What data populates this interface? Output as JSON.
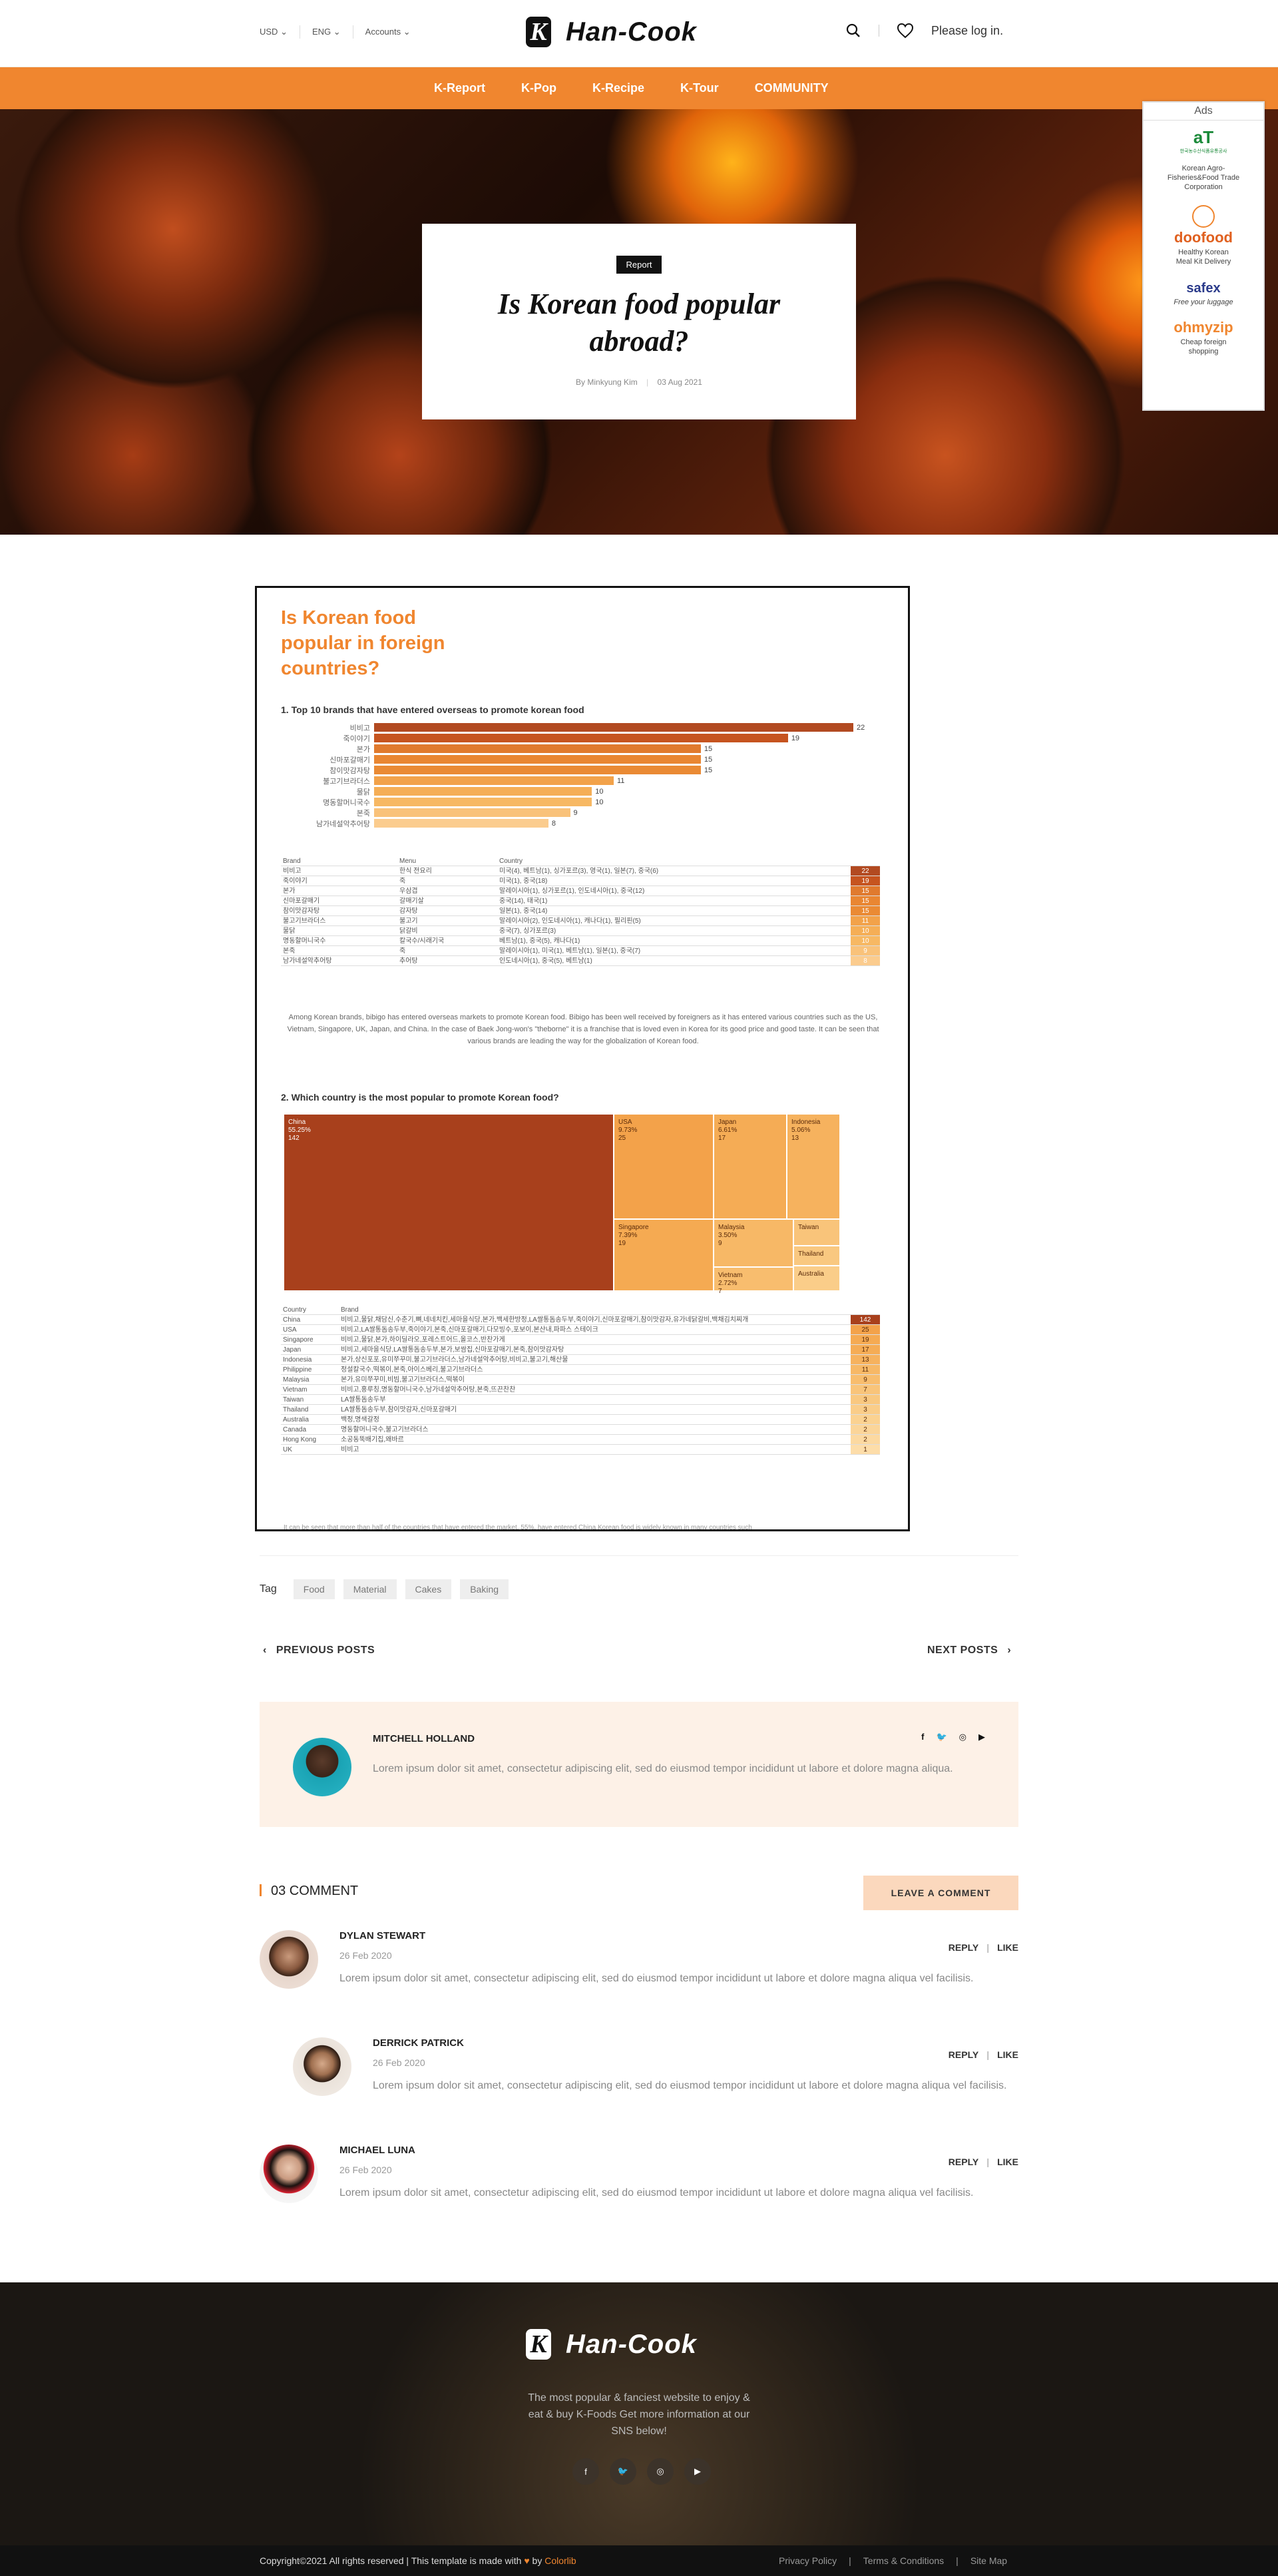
{
  "header": {
    "currency": "USD",
    "language": "ENG",
    "accounts": "Accounts",
    "brand": "Han-Cook",
    "brand_mark": "K",
    "login": "Please log in."
  },
  "nav": [
    "K-Report",
    "K-Pop",
    "K-Recipe",
    "K-Tour",
    "COMMUNITY"
  ],
  "hero": {
    "badge": "Report",
    "title": "Is Korean food popular abroad?",
    "author": "By Minkyung Kim",
    "date": "03 Aug 2021"
  },
  "ads": {
    "title": "Ads",
    "items": [
      {
        "logo": "aT",
        "sub": "한국농수산식품유통공사",
        "desc": "Korean Agro-Fisheries&Food Trade Corporation"
      },
      {
        "logo": "doofood",
        "desc": "Healthy Korean Meal Kit Delivery"
      },
      {
        "logo": "safex",
        "desc": "Free your luggage"
      },
      {
        "logo": "ohmyzip",
        "desc": "Cheap foreign shopping"
      }
    ]
  },
  "article": {
    "heading": "Is Korean food popular in foreign countries?",
    "section1": "1. Top 10 brands that have entered overseas to promote korean food",
    "section2": "2. Which country is the most popular to promote Korean food?",
    "brand_headers": [
      "Brand",
      "Menu",
      "Country"
    ],
    "brand_rows": [
      [
        "비비고",
        "한식 전요리",
        "미국(4), 베트남(1), 싱가포르(3), 영국(1), 일본(7), 중국(6)",
        "22"
      ],
      [
        "죽이야기",
        "죽",
        "미국(1), 중국(18)",
        "19"
      ],
      [
        "본가",
        "우삼겹",
        "말레이시아(1), 싱가포르(1), 인도네시아(1), 중국(12)",
        "15"
      ],
      [
        "신마포갈매기",
        "갈매기살",
        "중국(14), 태국(1)",
        "15"
      ],
      [
        "참이맛감자탕",
        "감자탕",
        "일본(1), 중국(14)",
        "15"
      ],
      [
        "불고기브라더스",
        "불고기",
        "말레이시아(2), 인도네시아(1), 캐나다(1), 필리핀(5)",
        "11"
      ],
      [
        "물닭",
        "닭갈비",
        "중국(7), 싱가포르(3)",
        "10"
      ],
      [
        "명동할머니국수",
        "칼국수/시래기국",
        "베트남(1), 중국(5), 캐나다(1)",
        "10"
      ],
      [
        "본죽",
        "죽",
        "말레이시아(1), 미국(1), 베트남(1), 일본(1), 중국(7)",
        "9"
      ],
      [
        "남가네설악추어탕",
        "추어탕",
        "인도네시아(1), 중국(5), 베트남(1)",
        "8"
      ]
    ],
    "paragraph1": "Among Korean brands, bibigo has entered overseas markets to promote Korean food. Bibigo has been well received by foreigners as it has entered various countries such as the US, Vietnam, Singapore, UK, Japan, and China. In the case of Baek Jong-won's \"theborne\" it is a franchise that is loved even in Korea for its good price and good taste. It can be seen that various brands are leading the way for the globalization of Korean food.",
    "country_headers": [
      "Country",
      "Brand"
    ],
    "country_rows": [
      [
        "China",
        "비비고,물닭,채담신,수춘기,뼈,네네치킨,세마을식당,본가,백세한방정,LA쌀통돔송두부,죽이야기,신마포갈매기,참이맛감자,유가네닭갈비,백채김치찌개",
        "142"
      ],
      [
        "USA",
        "비비고,LA쌀통돔송두부,죽이야기,본죽,신마포갈매기,다모빙수,포보이,본산내,파파스 스테이크",
        "25"
      ],
      [
        "Singapore",
        "비비고,물닭,본가,하이딜라오,포레스트어드,올코스,반찬가게",
        "19"
      ],
      [
        "Japan",
        "비비고,세마을식당,LA쌀통돔송두부,본가,보쌈집,신마포갈매기,본죽,참이맛감자탕",
        "17"
      ],
      [
        "Indonesia",
        "본가,상신포포,유미쭈꾸미,불고기브라더스,남가네설악추어탕,비비고,불고기,해산물",
        "13"
      ],
      [
        "Philippine",
        "정설칼국수,떡볶이,본죽,아이스베리,불고기브라더스",
        "11"
      ],
      [
        "Malaysia",
        "본가,유미쭈꾸미,비빔,불고기브라더스,떡볶이",
        "9"
      ],
      [
        "Vietnam",
        "비비고,홍루칭,명동할머니국수,남가네설악추어탕,본죽,뜨끈찬찬",
        "7"
      ],
      [
        "Taiwan",
        "LA쌀통돔송두부",
        "3"
      ],
      [
        "Thailand",
        "LA쌀통돔송두부,참이맛감자,신마포갈매기",
        "3"
      ],
      [
        "Australia",
        "백정,명색갈정",
        "2"
      ],
      [
        "Canada",
        "명동할머니국수,불고기브라더스",
        "2"
      ],
      [
        "Hong Kong",
        "소공동뚝배기집,왜바르",
        "2"
      ],
      [
        "UK",
        "비비고",
        "1"
      ]
    ],
    "paragraph2": "It can be seen that more than half of the countries that have entered the market, 55%, have entered China Korean food is widely known in many countries such"
  },
  "chart_data": [
    {
      "type": "bar",
      "title": "1. Top 10 brands that have entered overseas to promote korean food",
      "categories": [
        "비비고",
        "죽이야기",
        "본가",
        "신마포갈매기",
        "참이맛감자탕",
        "불고기브라더스",
        "물닭",
        "명동할머니국수",
        "본죽",
        "남가네설악추어탕"
      ],
      "values": [
        22,
        19,
        15,
        15,
        15,
        11,
        10,
        10,
        9,
        8
      ],
      "orientation": "horizontal",
      "colors": [
        "#b24a21",
        "#c6541f",
        "#e07a2e",
        "#e98632",
        "#ea8a34",
        "#f2a24a",
        "#f5ae56",
        "#f7b863",
        "#f9c27a",
        "#fbcc8e"
      ]
    },
    {
      "type": "treemap",
      "title": "2. Which country is the most popular to promote Korean food?",
      "items": [
        {
          "name": "China",
          "pct": "55.25%",
          "value": 142
        },
        {
          "name": "USA",
          "pct": "9.73%",
          "value": 25
        },
        {
          "name": "Japan",
          "pct": "6.61%",
          "value": 17
        },
        {
          "name": "Indonesia",
          "pct": "5.06%",
          "value": 13
        },
        {
          "name": "Singapore",
          "pct": "7.39%",
          "value": 19
        },
        {
          "name": "Malaysia",
          "pct": "3.50%",
          "value": 9
        },
        {
          "name": "Vietnam",
          "pct": "2.72%",
          "value": 7
        },
        {
          "name": "Taiwan",
          "value": 3
        },
        {
          "name": "Thailand",
          "value": 3
        },
        {
          "name": "Australia",
          "value": 2
        }
      ]
    }
  ],
  "tags": {
    "label": "Tag",
    "items": [
      "Food",
      "Material",
      "Cakes",
      "Baking"
    ]
  },
  "postnav": {
    "prev": "PREVIOUS POSTS",
    "next": "NEXT POSTS"
  },
  "author": {
    "name": "MITCHELL HOLLAND",
    "bio": "Lorem ipsum dolor sit amet, consectetur adipiscing elit, sed do eiusmod tempor incididunt ut labore et dolore magna aliqua.",
    "social": [
      "f",
      "t",
      "ig",
      "yt"
    ]
  },
  "comments": {
    "count_label": "03 COMMENT",
    "leave": "LEAVE A COMMENT",
    "reply": "REPLY",
    "like": "LIKE",
    "items": [
      {
        "name": "DYLAN STEWART",
        "date": "26 Feb 2020",
        "text": "Lorem ipsum dolor sit amet, consectetur adipiscing elit, sed do eiusmod tempor incididunt ut labore et dolore magna aliqua vel facilisis."
      },
      {
        "name": "DERRICK PATRICK",
        "date": "26 Feb 2020",
        "text": "Lorem ipsum dolor sit amet, consectetur adipiscing elit, sed do eiusmod tempor incididunt ut labore et dolore magna aliqua vel facilisis."
      },
      {
        "name": "MICHAEL LUNA",
        "date": "26 Feb 2020",
        "text": "Lorem ipsum dolor sit amet, consectetur adipiscing elit, sed do eiusmod tempor incididunt ut labore et dolore magna aliqua vel facilisis."
      }
    ]
  },
  "footer": {
    "brand": "Han-Cook",
    "brand_mark": "K",
    "text": "The most popular & fanciest website to enjoy & eat & buy K-Foods Get more information at our SNS below!",
    "social": [
      "f",
      "t",
      "ig",
      "yt"
    ],
    "copyright": "Copyright©2021 All rights reserved | This template is made with",
    "heart": "♥",
    "by": "by",
    "credit": "Colorlib",
    "links": [
      "Privacy Policy",
      "|",
      "Terms & Conditions",
      "|",
      "Site Map"
    ]
  },
  "colors": {
    "accent": "#f0862f",
    "dark": "#111111",
    "bar_dark": "#b24a21"
  }
}
